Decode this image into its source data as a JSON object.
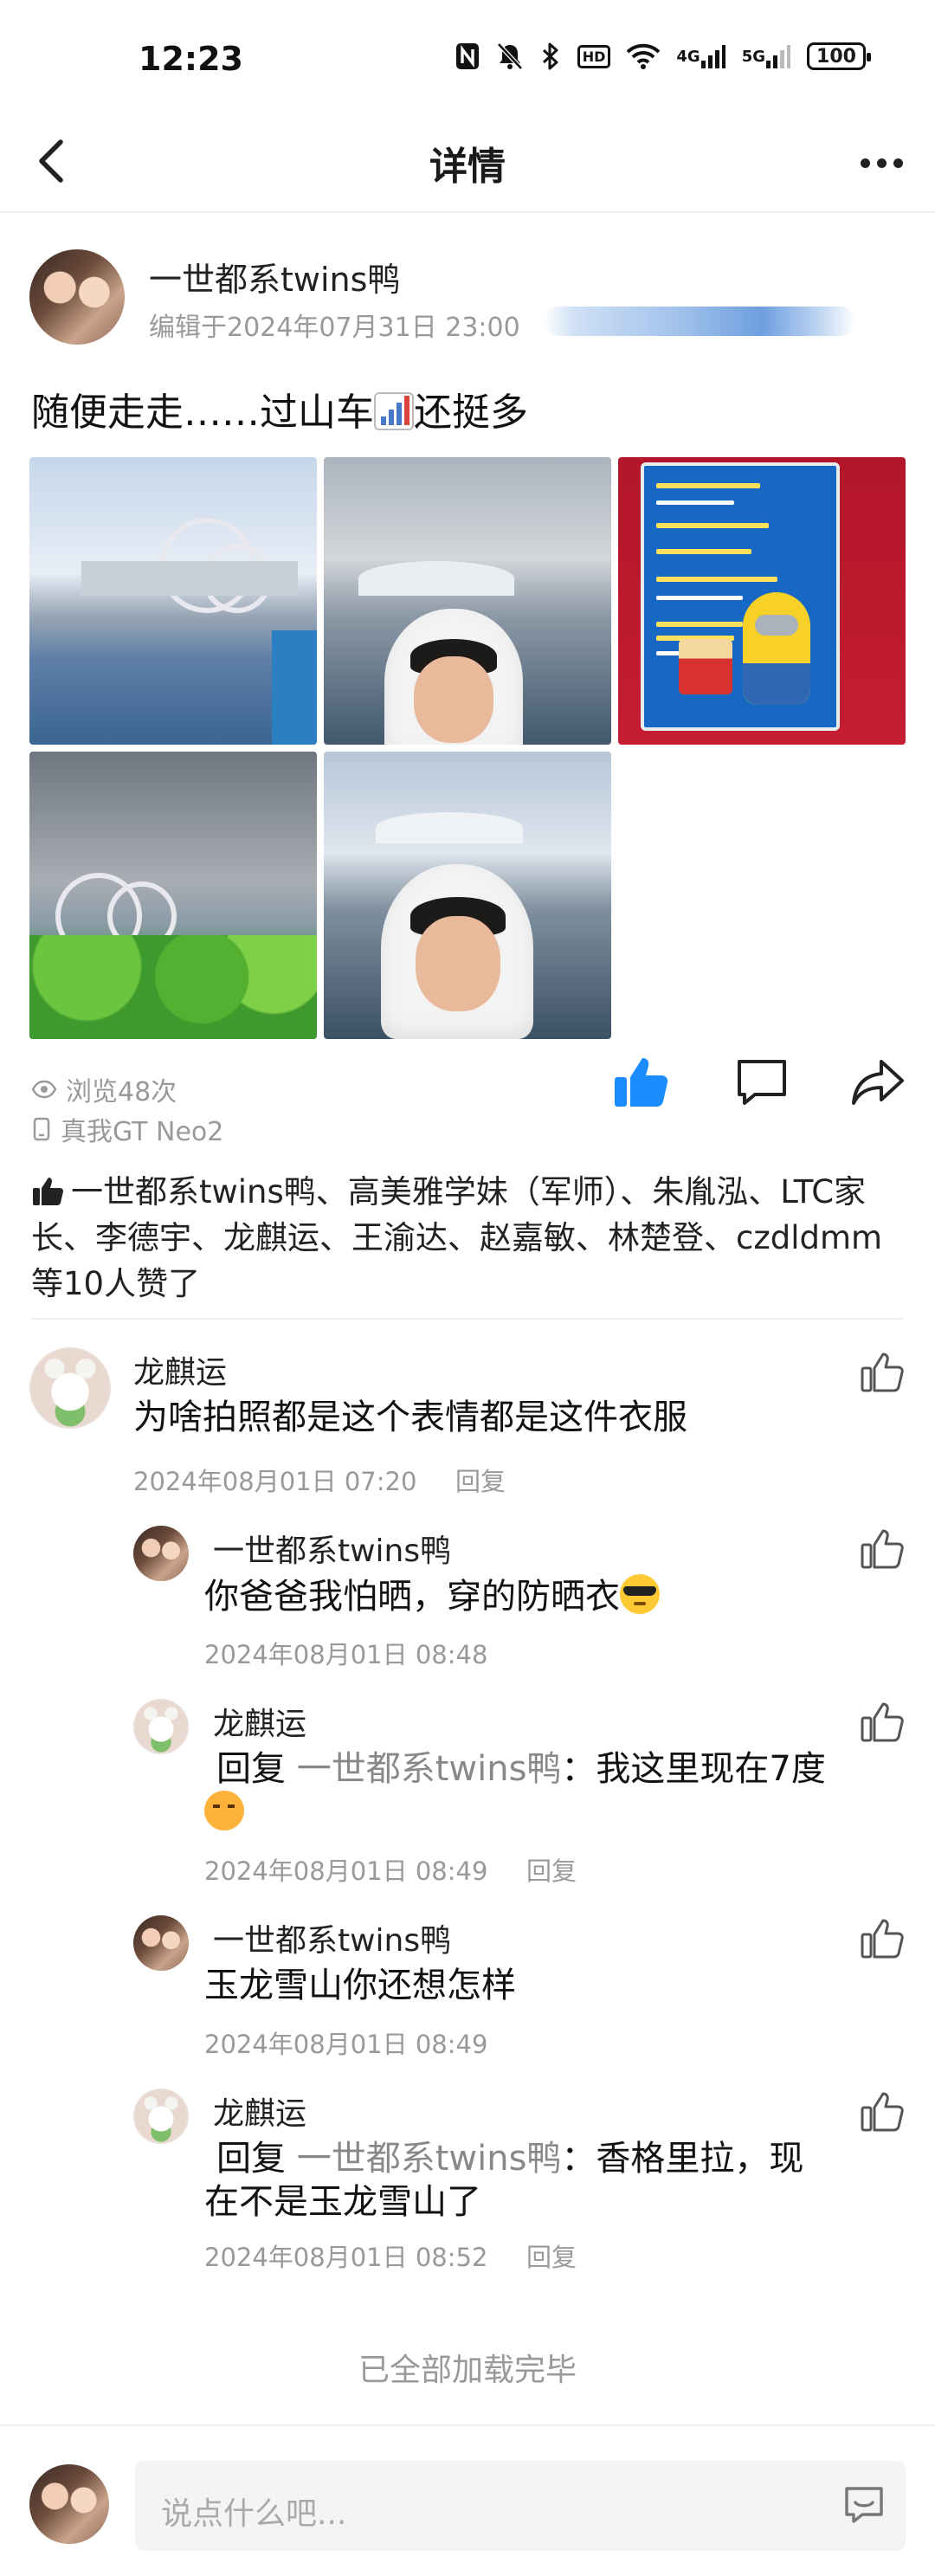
{
  "status_bar": {
    "time": "12:23",
    "icons": [
      "nfc-icon",
      "mute-icon",
      "bluetooth-icon",
      "hd-icon",
      "wifi-icon",
      "signal-4g-icon",
      "signal-5g-icon",
      "battery-icon"
    ],
    "hd_label": "HD",
    "sig1_label": "4G",
    "sig2_label": "5G",
    "battery": "100"
  },
  "nav": {
    "title": "详情"
  },
  "post": {
    "author": "一世都系twins鸭",
    "meta": "编辑于2024年07月31日 23:00",
    "text_before": "随便走走……过山车",
    "text_after": "还挺多",
    "photos": [
      "roller-coaster-lake",
      "selfie-white-hood",
      "popcorn-minion-menu",
      "roller-coaster-greenery",
      "selfie-white-hood-2"
    ],
    "views": "浏览48次",
    "device": "真我GT Neo2"
  },
  "likers": {
    "text": "一世都系twins鸭、高美雅学妹（军师）、朱胤泓、LTC家长、李德宇、龙麒运、王渝达、赵嘉敏、林楚登、czdldmm等10人赞了"
  },
  "comments": [
    {
      "name": "龙麒运",
      "text": "为啥拍照都是这个表情都是这件衣服",
      "time": "2024年08月01日 07:20",
      "reply_label": "回复"
    }
  ],
  "replies": [
    {
      "name": "一世都系twins鸭",
      "text": "你爸爸我怕晒，穿的防晒衣",
      "time": "2024年08月01日 08:48"
    },
    {
      "name": "龙麒运",
      "prefix": "回复",
      "reply_to": "一世都系twins鸭",
      "text": "：我这里现在7度",
      "time": "2024年08月01日 08:49",
      "reply_label": "回复"
    },
    {
      "name": "一世都系twins鸭",
      "text": "玉龙雪山你还想怎样",
      "time": "2024年08月01日 08:49"
    },
    {
      "name": "龙麒运",
      "prefix": "回复",
      "reply_to": "一世都系twins鸭",
      "text": "：香格里拉，现在不是玉龙雪山了",
      "time": "2024年08月01日 08:52",
      "reply_label": "回复"
    }
  ],
  "footer": {
    "loaded_all": "已全部加载完毕",
    "input_placeholder": "说点什么吧..."
  },
  "colors": {
    "like_active": "#1a8cff",
    "meta_gray": "#999999",
    "text_dark": "#111111"
  }
}
